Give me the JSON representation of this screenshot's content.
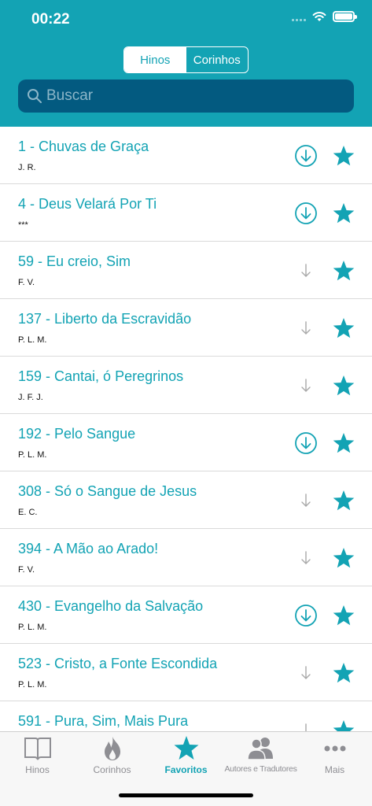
{
  "status": {
    "time": "00:22"
  },
  "segments": [
    {
      "label": "Hinos",
      "active": false
    },
    {
      "label": "Corinhos",
      "active": true
    }
  ],
  "search": {
    "placeholder": "Buscar"
  },
  "hymns": [
    {
      "title": "1 - Chuvas de Graça",
      "author": "J. R.",
      "downloaded": true
    },
    {
      "title": "4 - Deus Velará Por Ti",
      "author": "***",
      "downloaded": true
    },
    {
      "title": "59 - Eu creio, Sim",
      "author": "F. V.",
      "downloaded": false
    },
    {
      "title": "137 - Liberto da Escravidão",
      "author": "P. L. M.",
      "downloaded": false
    },
    {
      "title": "159 - Cantai, ó Peregrinos",
      "author": "J. F. J.",
      "downloaded": false
    },
    {
      "title": "192 - Pelo Sangue",
      "author": "P. L. M.",
      "downloaded": true
    },
    {
      "title": "308 - Só o Sangue de Jesus",
      "author": "E. C.",
      "downloaded": false
    },
    {
      "title": "394 - A Mão ao Arado!",
      "author": "F. V.",
      "downloaded": false
    },
    {
      "title": "430 - Evangelho da Salvação",
      "author": "P. L. M.",
      "downloaded": true
    },
    {
      "title": "523 - Cristo, a Fonte Escondida",
      "author": "P. L. M.",
      "downloaded": false
    },
    {
      "title": "591 - Pura, Sim, Mais Pura",
      "author": "",
      "downloaded": false
    }
  ],
  "tabs": [
    {
      "label": "Hinos",
      "icon": "book-icon"
    },
    {
      "label": "Corinhos",
      "icon": "flame-icon"
    },
    {
      "label": "Favoritos",
      "icon": "star-icon",
      "active": true
    },
    {
      "label": "Autores e Tradutores",
      "icon": "people-icon"
    },
    {
      "label": "Mais",
      "icon": "more-icon"
    }
  ],
  "colors": {
    "accent": "#13a3b4",
    "search_bg": "#035a80",
    "inactive": "#8e8e93"
  }
}
